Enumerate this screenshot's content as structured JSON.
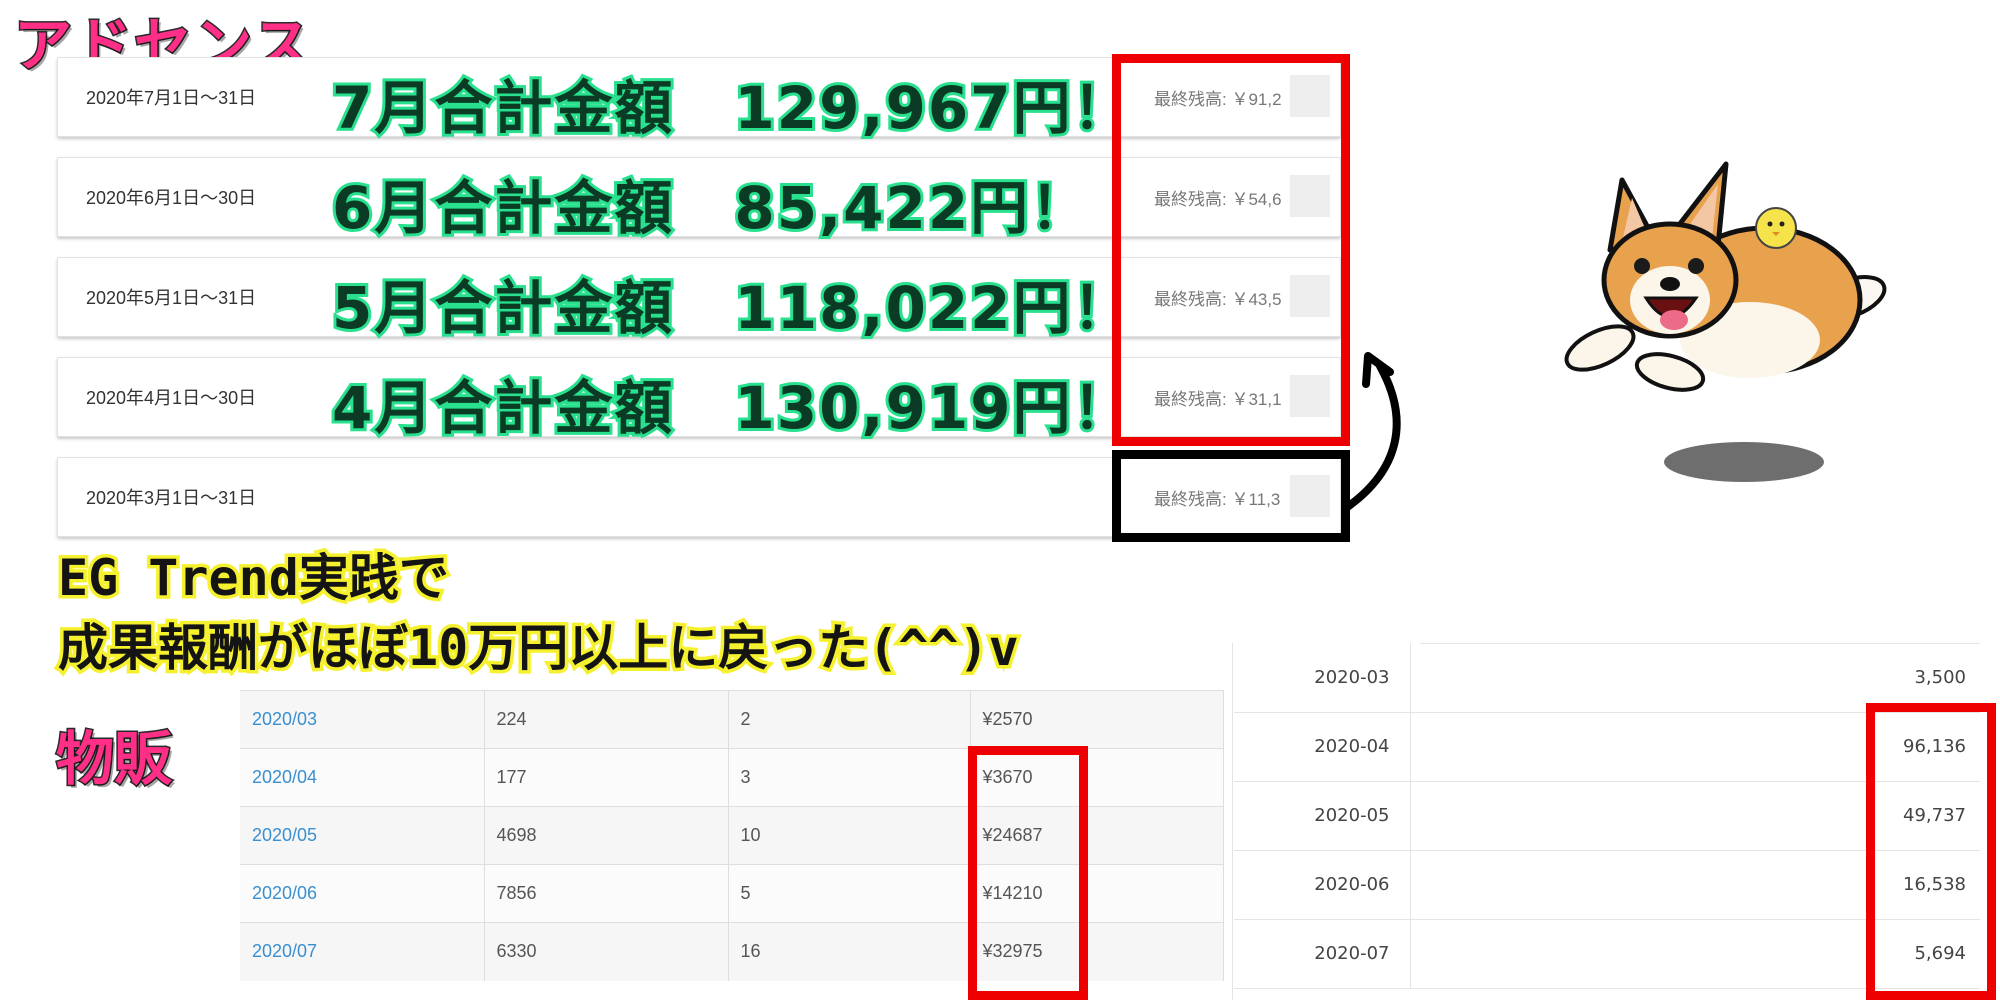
{
  "adsense": {
    "title": "アドセンス",
    "periods": [
      {
        "date": "2020年7月1日～31日",
        "balance": "最終残高: ￥91,2",
        "total": "7月合計金額　129,967円！"
      },
      {
        "date": "2020年6月1日～30日",
        "balance": "最終残高: ￥54,6",
        "total": "6月合計金額　85,422円！"
      },
      {
        "date": "2020年5月1日～31日",
        "balance": "最終残高: ￥43,5",
        "total": "5月合計金額　118,022円！"
      },
      {
        "date": "2020年4月1日～30日",
        "balance": "最終残高: ￥31,1",
        "total": "4月合計金額　130,919円！"
      },
      {
        "date": "2020年3月1日～31日",
        "balance": "最終残高: ￥11,3",
        "total": ""
      }
    ]
  },
  "message": {
    "line1": "EG Trend実践で",
    "line2": "成果報酬がほぼ10万円以上に戻った(^^)v"
  },
  "buppan": {
    "title": "物販",
    "rows": [
      {
        "month": "2020/03",
        "a": "224",
        "b": "2",
        "amount": "¥2570"
      },
      {
        "month": "2020/04",
        "a": "177",
        "b": "3",
        "amount": "¥3670"
      },
      {
        "month": "2020/05",
        "a": "4698",
        "b": "10",
        "amount": "¥24687"
      },
      {
        "month": "2020/06",
        "a": "7856",
        "b": "5",
        "amount": "¥14210"
      },
      {
        "month": "2020/07",
        "a": "6330",
        "b": "16",
        "amount": "¥32975"
      }
    ]
  },
  "monthly": {
    "rows": [
      {
        "month": "2020-03",
        "value": "3,500"
      },
      {
        "month": "2020-04",
        "value": "96,136"
      },
      {
        "month": "2020-05",
        "value": "49,737"
      },
      {
        "month": "2020-06",
        "value": "16,538"
      },
      {
        "month": "2020-07",
        "value": "5,694"
      }
    ]
  },
  "colors": {
    "highlight_red": "#ef0000",
    "highlight_black": "#000000",
    "title_pink": "#ff2e86",
    "total_glow": "#28e08e",
    "message_glow": "#f6f12e",
    "link_blue": "#3a8fcf"
  },
  "illustration": {
    "subject": "corgi-running-with-chick"
  }
}
